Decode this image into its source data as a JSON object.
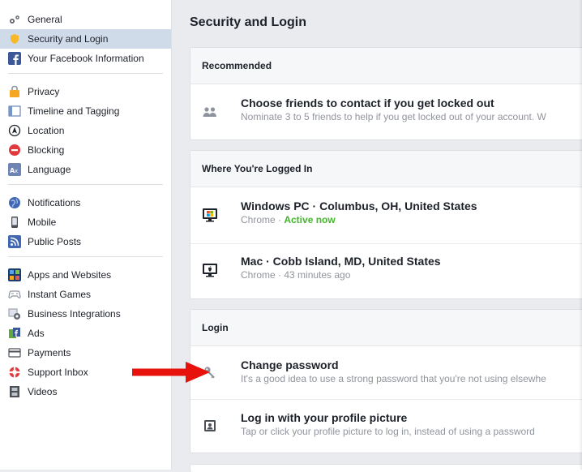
{
  "sidebar": {
    "groups": [
      [
        {
          "label": "General",
          "icon": "gears-icon"
        },
        {
          "label": "Security and Login",
          "icon": "badge-icon",
          "active": true
        },
        {
          "label": "Your Facebook Information",
          "icon": "facebook-icon"
        }
      ],
      [
        {
          "label": "Privacy",
          "icon": "lock-icon"
        },
        {
          "label": "Timeline and Tagging",
          "icon": "timeline-icon"
        },
        {
          "label": "Location",
          "icon": "location-icon"
        },
        {
          "label": "Blocking",
          "icon": "blocking-icon"
        },
        {
          "label": "Language",
          "icon": "language-icon"
        }
      ],
      [
        {
          "label": "Notifications",
          "icon": "globe-icon"
        },
        {
          "label": "Mobile",
          "icon": "mobile-icon"
        },
        {
          "label": "Public Posts",
          "icon": "rss-icon"
        }
      ],
      [
        {
          "label": "Apps and Websites",
          "icon": "apps-icon"
        },
        {
          "label": "Instant Games",
          "icon": "gamepad-icon"
        },
        {
          "label": "Business Integrations",
          "icon": "business-icon"
        },
        {
          "label": "Ads",
          "icon": "ads-icon"
        },
        {
          "label": "Payments",
          "icon": "card-icon"
        },
        {
          "label": "Support Inbox",
          "icon": "lifebuoy-icon"
        },
        {
          "label": "Videos",
          "icon": "film-icon"
        }
      ]
    ]
  },
  "main": {
    "title": "Security and Login",
    "recommended": {
      "header": "Recommended",
      "title": "Choose friends to contact if you get locked out",
      "subtitle": "Nominate 3 to 5 friends to help if you get locked out of your account. W"
    },
    "logged_in": {
      "header": "Where You're Logged In",
      "sessions": [
        {
          "title": "Windows PC · Columbus, OH, United States",
          "browser": "Chrome · ",
          "status": "Active now"
        },
        {
          "title": "Mac · Cobb Island, MD, United States",
          "browser": "Chrome · 43 minutes ago",
          "status": ""
        }
      ]
    },
    "login": {
      "header": "Login",
      "change_password_title": "Change password",
      "change_password_sub": "It's a good idea to use a strong password that you're not using elsewhe",
      "profile_picture_title": "Log in with your profile picture",
      "profile_picture_sub": "Tap or click your profile picture to log in, instead of using a password"
    }
  },
  "colors": {
    "active_green": "#42b72a",
    "arrow_red": "#e8120c",
    "sidebar_active_bg": "#d0dbea",
    "facebook_blue": "#3b5998"
  }
}
